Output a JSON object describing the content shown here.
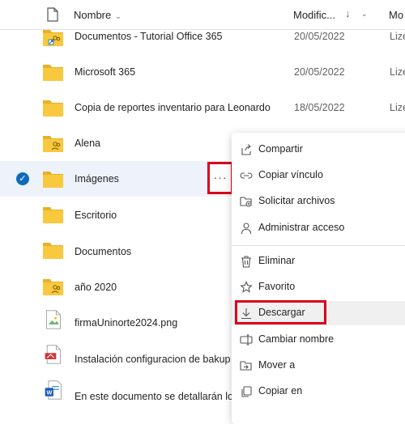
{
  "header": {
    "name_label": "Nombre",
    "modified_label": "Modific...",
    "sort_icon": "↓",
    "modifiedby_label": "Mo"
  },
  "rows": [
    {
      "name": "Documentos - Tutorial Office 365",
      "date": "20/05/2022",
      "modifiedby": "Lize",
      "icon": "shared-folder-icon"
    },
    {
      "name": "Microsoft 365",
      "date": "20/05/2022",
      "modifiedby": "Lize",
      "icon": "folder-icon"
    },
    {
      "name": "Copia de reportes inventario para Leonardo",
      "date": "18/05/2022",
      "modifiedby": "Lize",
      "icon": "folder-icon"
    },
    {
      "name": "Alena",
      "date": "",
      "modifiedby": "",
      "icon": "shared-folder-icon"
    },
    {
      "name": "Imágenes",
      "date": "",
      "modifiedby": "",
      "icon": "folder-icon",
      "selected": true
    },
    {
      "name": "Escritorio",
      "date": "",
      "modifiedby": "",
      "icon": "folder-icon"
    },
    {
      "name": "Documentos",
      "date": "",
      "modifiedby": "",
      "icon": "folder-icon"
    },
    {
      "name": "año 2020",
      "date": "",
      "modifiedby": "",
      "icon": "shared-folder-icon"
    },
    {
      "name": "firmaUninorte2024.png",
      "date": "",
      "modifiedby": "",
      "icon": "image-file-icon"
    },
    {
      "name": "Instalación configuracion de bakup",
      "date": "",
      "modifiedby": "",
      "icon": "pdf-file-icon"
    },
    {
      "name": "En este documento se detallarán lo",
      "date": "",
      "modifiedby": "",
      "icon": "word-file-icon"
    }
  ],
  "more_button": "···",
  "menu": [
    {
      "label": "Compartir",
      "icon": "share-icon"
    },
    {
      "label": "Copiar vínculo",
      "icon": "link-icon"
    },
    {
      "label": "Solicitar archivos",
      "icon": "request-files-icon"
    },
    {
      "label": "Administrar acceso",
      "icon": "person-icon"
    },
    {
      "label": "Eliminar",
      "icon": "trash-icon"
    },
    {
      "label": "Favorito",
      "icon": "star-icon"
    },
    {
      "label": "Descargar",
      "icon": "download-icon"
    },
    {
      "label": "Cambiar nombre",
      "icon": "rename-icon"
    },
    {
      "label": "Mover a",
      "icon": "move-icon"
    },
    {
      "label": "Copiar en",
      "icon": "copy-icon"
    }
  ],
  "colors": {
    "folder": "#f8c93e",
    "folder_dark": "#e8b028",
    "accent": "#0f6cbd",
    "highlight": "#d9001b",
    "selected_row": "#eef3fb"
  }
}
